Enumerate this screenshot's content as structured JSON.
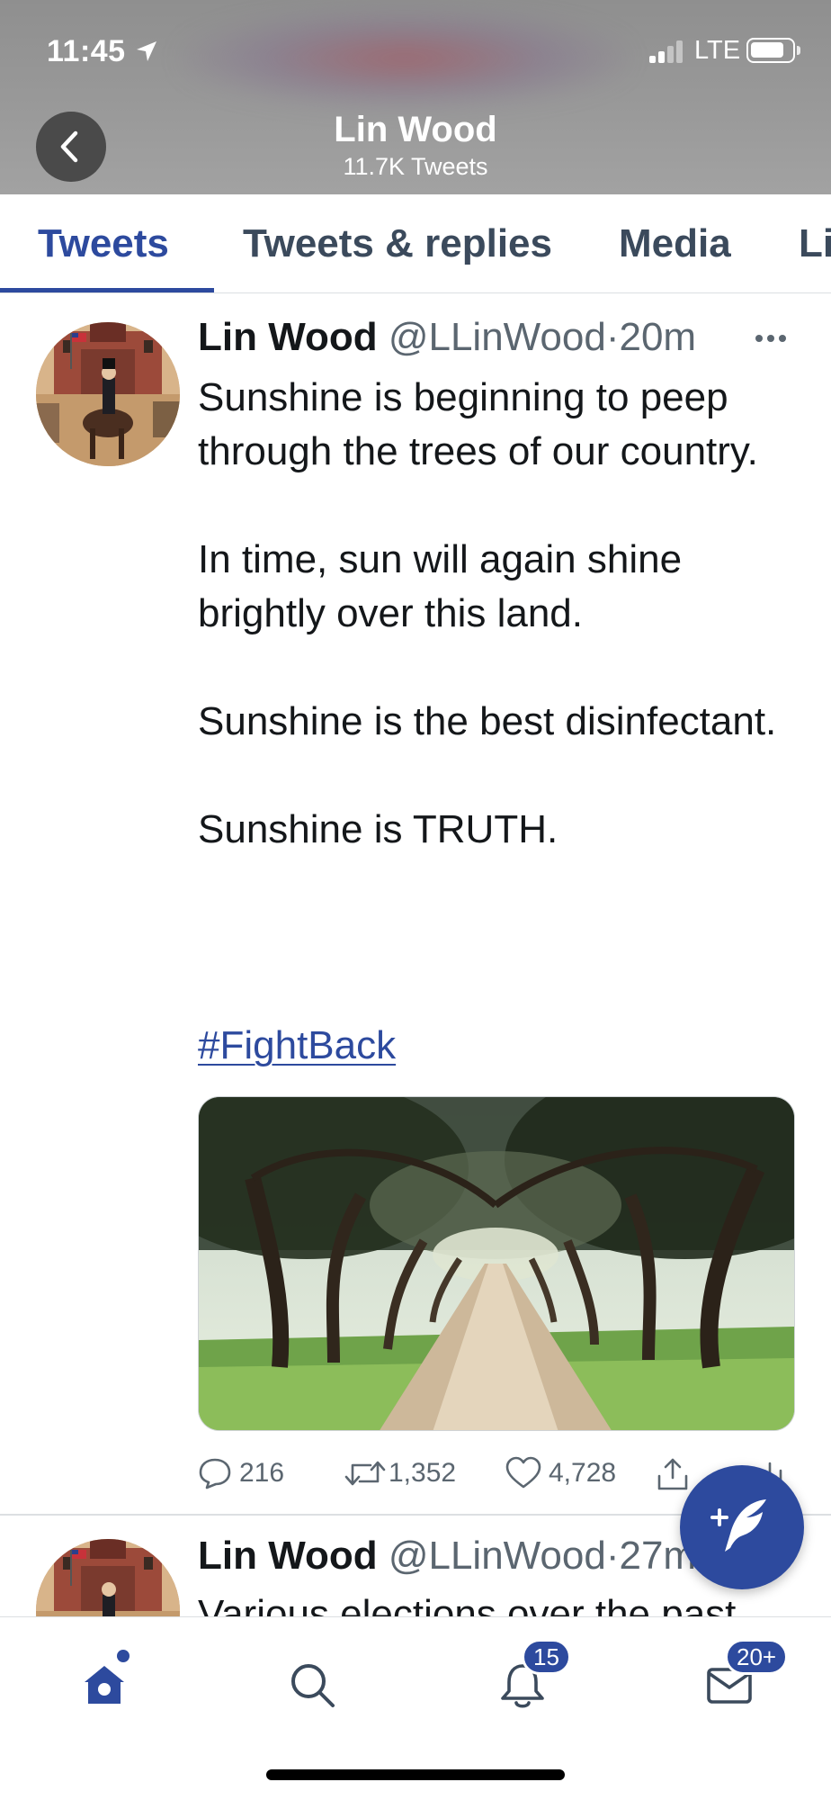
{
  "status_bar": {
    "time": "11:45",
    "network": "LTE"
  },
  "header": {
    "name": "Lin Wood",
    "tweet_count": "11.7K Tweets"
  },
  "tabs": [
    {
      "label": "Tweets",
      "active": true
    },
    {
      "label": "Tweets & replies",
      "active": false
    },
    {
      "label": "Media",
      "active": false
    },
    {
      "label": "Li",
      "active": false
    }
  ],
  "tweets": [
    {
      "author_name": "Lin Wood",
      "handle": "@LLinWood",
      "separator": "·",
      "time": "20m",
      "paragraphs": [
        "Sunshine is beginning to peep through the trees of our country.",
        "In time, sun will again shine brightly over this land.",
        "Sunshine is the best disinfectant.",
        "Sunshine is TRUTH."
      ],
      "hashtag": "#FightBack",
      "replies": "216",
      "retweets": "1,352",
      "likes": "4,728"
    },
    {
      "author_name": "Lin Wood",
      "handle": "@LLinWood",
      "separator": "·",
      "time": "27m",
      "text_peek": "Various elections over the past"
    }
  ],
  "bottom_nav": {
    "notifications_badge": "15",
    "messages_badge": "20+"
  },
  "colors": {
    "accent": "#2d4a9e",
    "header_bg": "#9a9a9a",
    "text_primary": "#14171a",
    "text_secondary": "#5b6670"
  }
}
